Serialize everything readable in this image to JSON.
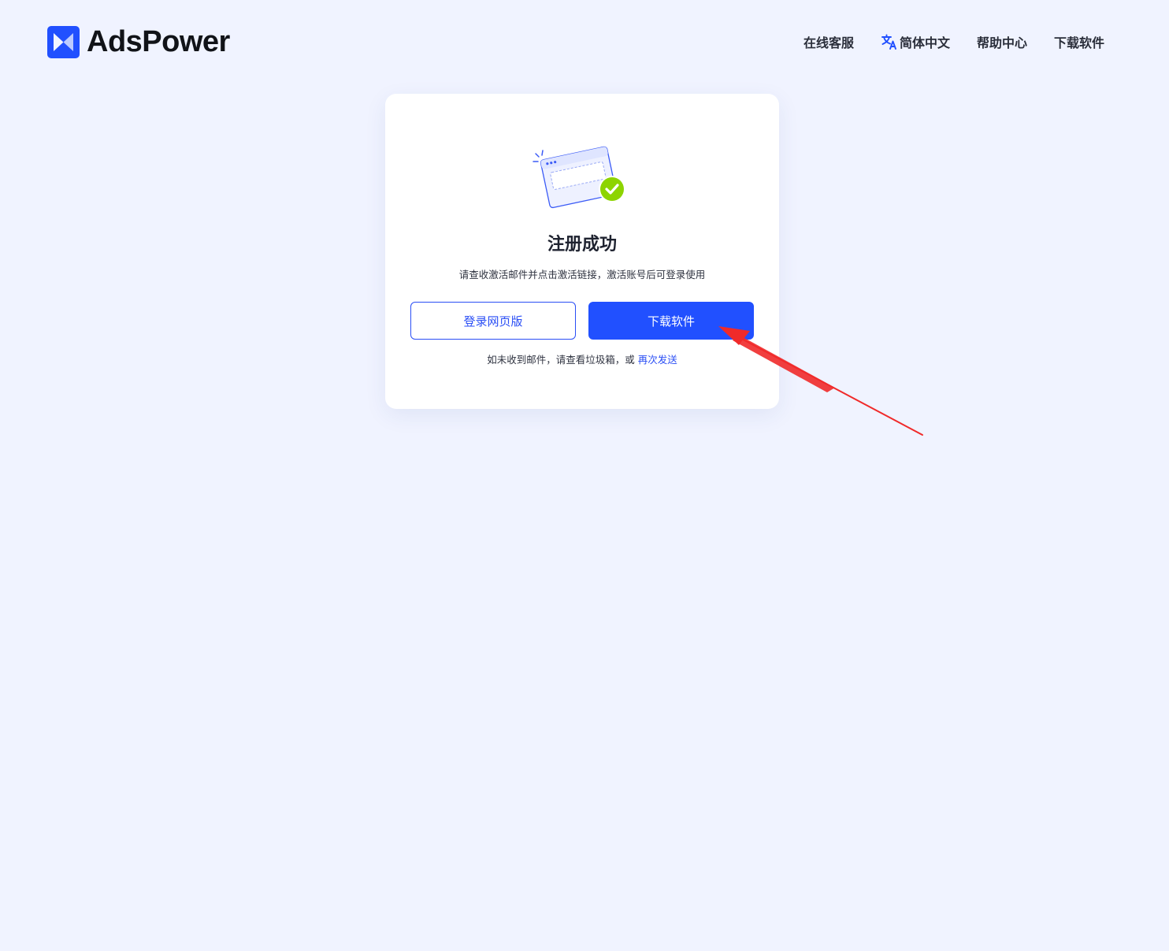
{
  "header": {
    "brand": "AdsPower",
    "nav": {
      "support": "在线客服",
      "language": "简体中文",
      "help": "帮助中心",
      "download": "下载软件"
    }
  },
  "card": {
    "title": "注册成功",
    "description": "请查收激活邮件并点击激活链接，激活账号后可登录使用",
    "buttons": {
      "web_login": "登录网页版",
      "download": "下载软件"
    },
    "footnote_text": "如未收到邮件，请查看垃圾箱，或",
    "resend_link": "再次发送"
  },
  "colors": {
    "accent": "#2150ff",
    "background": "#f0f3ff",
    "success": "#8dd400",
    "annotation_arrow": "#f02a2a"
  },
  "icons": {
    "brand": "adspower-logo-icon",
    "language": "translate-icon",
    "illustration": "browser-window-check-icon"
  }
}
